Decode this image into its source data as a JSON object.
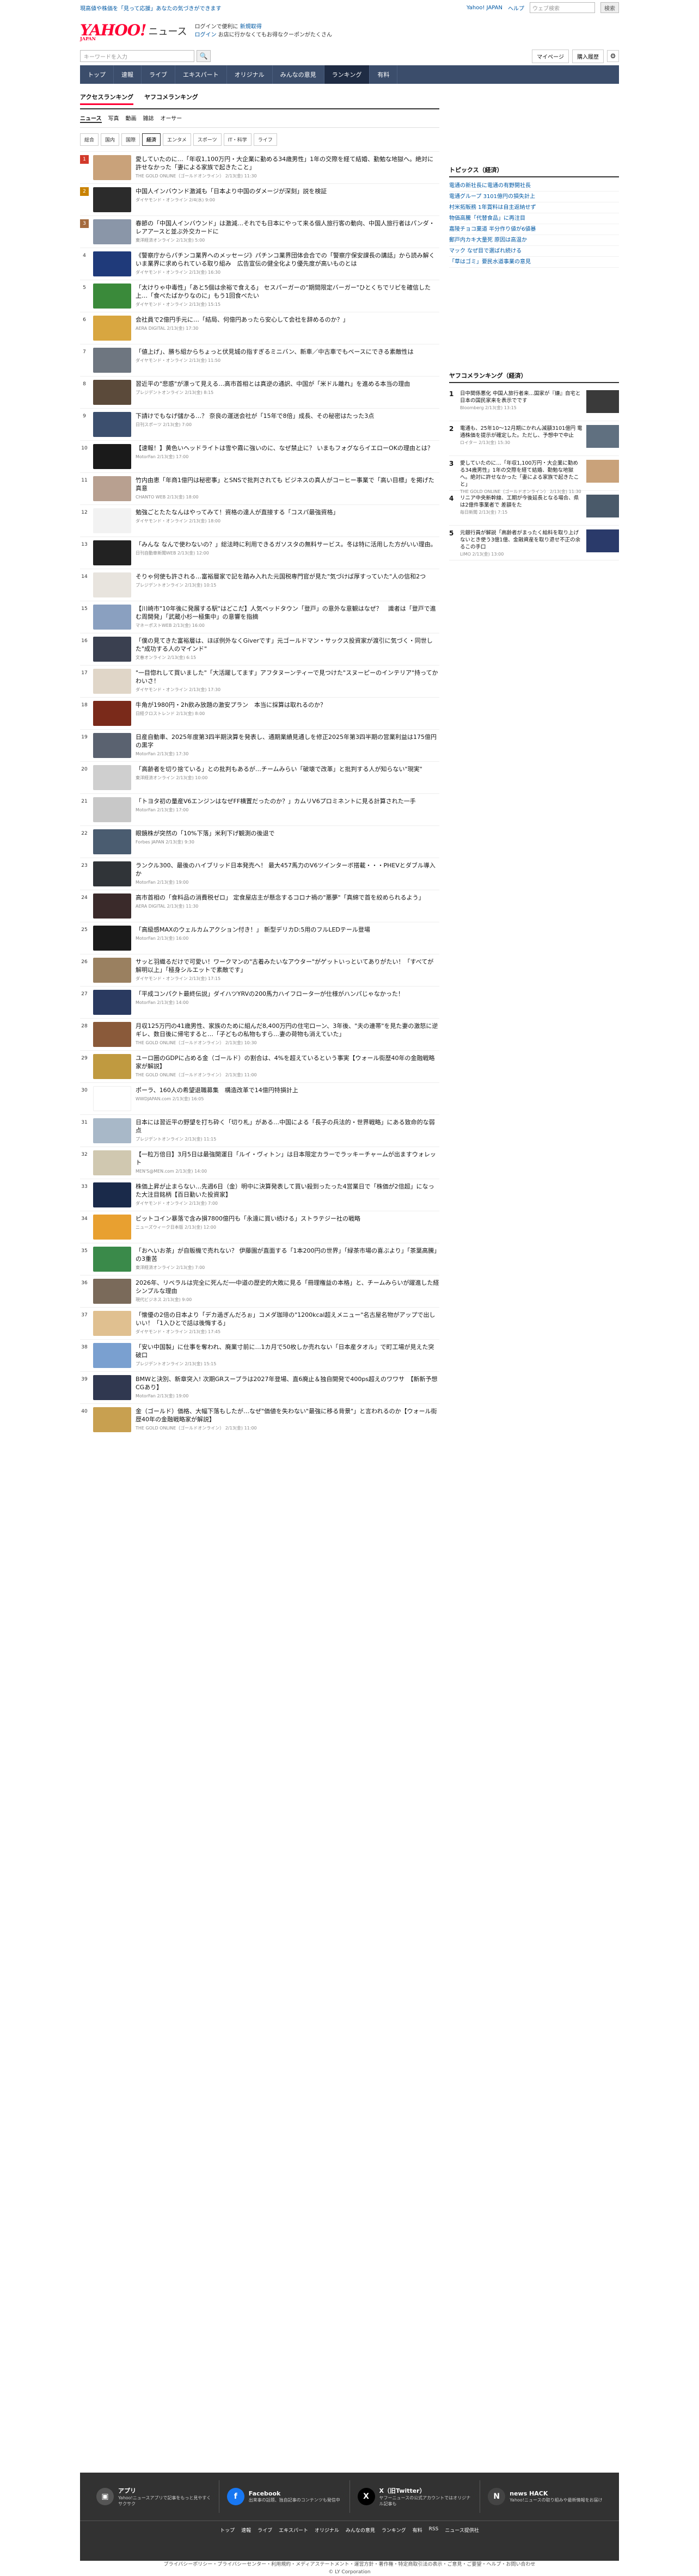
{
  "header": {
    "notice": "現高値や株価を「見って応援」あなたの気づきができます",
    "links": [
      "Yahoo! JAPAN",
      "ヘルプ"
    ],
    "search_placeholder": "ウェブ検索",
    "search_btn": "検索",
    "promo_line1": "ログインで便利に",
    "promo_line2": "新規取得",
    "promo_line3": "ログイン",
    "promo_line4": "お店に行かなくてもお得なクーポンがたくさん",
    "logo": "YAHOO!",
    "logo_sub": "JAPAN",
    "news": "ニュース",
    "kw_placeholder": "キーワードを入力",
    "mypage": "マイページ",
    "buy": "購入履歴"
  },
  "nav": [
    "トップ",
    "速報",
    "ライブ",
    "エキスパート",
    "オリジナル",
    "みんなの意見",
    "ランキング",
    "有料"
  ],
  "nav_active": 6,
  "tabs1": [
    "アクセスランキング",
    "ヤフコメランキング"
  ],
  "tabs2": [
    "ニュース",
    "写真",
    "動画",
    "雑誌",
    "オーサー"
  ],
  "tabs3": [
    "総合",
    "国内",
    "国際",
    "経済",
    "エンタメ",
    "スポーツ",
    "IT・科学",
    "ライフ"
  ],
  "items": [
    {
      "n": "1",
      "t": "愛していたのに…「年収1,100万円・大企業に勤める34歳男性」1年の交際を経て結婚、勤勉な地獄へ。絶対に許せなかった「妻による家族で起きたこと」",
      "s": "THE GOLD ONLINE（ゴールドオンライン） 2/13(金) 11:30",
      "c": "#c9a27a"
    },
    {
      "n": "2",
      "t": "中国人インバウンド激減も「日本より中国のダメージが深刻」説を検証",
      "s": "ダイヤモンド・オンライン 2/4(水) 9:00",
      "c": "#2b2b2b"
    },
    {
      "n": "3",
      "t": "春節の「中国人インバウンド」は激減…それでも日本にやって来る個人旅行客の動向、中国人旅行者はパンダ・レアアースと並ぶ外交カードに",
      "s": "東洋経済オンライン 2/13(金) 5:00",
      "c": "#8a96a8"
    },
    {
      "n": "4",
      "t": "《警察庁からパチンコ業界へのメッセージ》パチンコ業界団体会合での「警察庁保安課長の講話」から読み解くいま業界に求められている取り組み　広告宣伝の健全化より優先度が高いものとは",
      "s": "ダイヤモンド・オンライン 2/13(金) 16:30",
      "c": "#1f3a7a"
    },
    {
      "n": "5",
      "t": "「太けりゃ中毒性」「あと5個は余裕で食える」 セスパーガーの\"期間限定バーガー\"ひとくちでリピを確信した上…「食べたばかりなのに」もう1回食べたい",
      "s": "ダイヤモンド・オンライン 2/13(金) 15:15",
      "c": "#3a8a3a"
    },
    {
      "n": "6",
      "t": "会社員で2億円手元に…「結局、何億円あったら安心して会社を辞めるのか？」",
      "s": "AERA DIGITAL 2/13(金) 17:30",
      "c": "#d8a640"
    },
    {
      "n": "7",
      "t": "「値上げ」、勝ち組からちょっと伏見城の指すぎるミニバン、新車／中古車でもベースにできる素敵性は",
      "s": "ダイヤモンド・オンライン 2/13(金) 11:50",
      "c": "#6e7680"
    },
    {
      "n": "8",
      "t": "習近平の\"悲惑\"が漂って見える…高市首相とは真逆の通訳、中国が「米ドル離れ」を進める本当の理由",
      "s": "プレジデントオンライン 2/13(金) 8:15",
      "c": "#5b4a3a"
    },
    {
      "n": "9",
      "t": "下請けでもなげ儲かる…？ 奈良の運送会社が「15年で8倍」成長、その秘密はたった3点",
      "s": "日刊スポーツ 2/13(金) 7:00",
      "c": "#3c4f6e"
    },
    {
      "n": "10",
      "t": "【速報！】黄色いヘッドライトは雪や霧に強いのに、なぜ禁止に？ いまもフォグならイエローOKの理由とは？",
      "s": "MotorFan 2/13(金) 17:00",
      "c": "#1a1a1a"
    },
    {
      "n": "11",
      "t": "竹内由恵「年商1億円は秘密事」とSNSで批判されても ビジネスの真人がコーヒー事業で「高い目標」を掲げた真意",
      "s": "CHANTO WEB 2/13(金) 18:00",
      "c": "#b8a090"
    },
    {
      "n": "12",
      "t": "勉強ごとたたなんはやってみて！資格の達人が直接する「コスパ最強資格」",
      "s": "ダイヤモンド・オンライン 2/13(金) 18:00",
      "c": "#f2f2f2"
    },
    {
      "n": "13",
      "t": "「みんな なんで使わないの？」総法時に利用できるガソスタの無料サービス。冬は特に活用した方がいい理由。",
      "s": "日刊自動車新聞WEB 2/13(金) 12:00",
      "c": "#222222"
    },
    {
      "n": "14",
      "t": "そりゃ何使も許される…富裕層家で記を踏み入れた元国税専門官が見た\"気づけば厚すっていた\"人の信和2つ",
      "s": "プレジデントオンライン 2/13(金) 10:15",
      "c": "#e8e4de"
    },
    {
      "n": "15",
      "t": "【川崎市\"10年後に発展する駅\"はどこだ】人気ベッドタウン「登戸」の意外な意観はなぜ？　識者は「登戸で進む周開発」「武蔵小杉一極集中」の意響を指摘",
      "s": "マネーポストWEB 2/13(金) 16:00",
      "c": "#8aa0c0"
    },
    {
      "n": "16",
      "t": "「僕の見てきた富裕層は、ほぼ例外なくGiverです」元ゴールドマン・サックス投資家が渡引に気づく・同世した\"成功する人のマインド\"",
      "s": "文春オンライン 2/13(金) 6:15",
      "c": "#3a4050"
    },
    {
      "n": "17",
      "t": "\"一目惚れして買いました\"「大活躍してます」アフタヌーンティーで見つけた\"スヌーピーのインテリア\"持ってかわいさ！",
      "s": "ダイヤモンド・オンライン 2/13(金) 17:30",
      "c": "#e0d6c8"
    },
    {
      "n": "18",
      "t": "牛角が1980円・2h飲み放題の激安プラン　本当に採算は取れるのか？",
      "s": "日経クロストレンド 2/13(金) 8:00",
      "c": "#7a2a1a"
    },
    {
      "n": "19",
      "t": "日産自動車、2025年度第3四半期決算を発表し、通期業績見通しを修正2025年第3四半期の営業利益は175億円の黒字",
      "s": "MotorFan 2/13(金) 17:30",
      "c": "#5a6270"
    },
    {
      "n": "20",
      "t": "「高齢者を切り捨ている」との批判もあるが…チームみらい「破壊で改革」と批判する人が知らない\"現実\"",
      "s": "東洋経済オンライン 2/13(金) 10:00",
      "c": "#cfcfcf"
    },
    {
      "n": "21",
      "t": "「トヨタ初の量産V6エンジンはなぜFF横置だったのか？」カムリV6プロミネントに見る計算された一手",
      "s": "MotorFan 2/13(金) 17:00",
      "c": "#c8c8c8"
    },
    {
      "n": "22",
      "t": "眼鏡株が突然の「10%下落」米利下げ観測の後退で",
      "s": "Forbes JAPAN 2/13(金) 9:30",
      "c": "#4a5c70"
    },
    {
      "n": "23",
      "t": "ランクル300、最後のハイブリッド日本発売へ！ 最大457馬力のV6ツインターボ搭載・・・PHEVとダブル導入か",
      "s": "MotorFan 2/13(金) 19:00",
      "c": "#303438"
    },
    {
      "n": "24",
      "t": "高市首相の「食料品の消費税ゼロ」 定食屋店主が懸念するコロナ禍の\"悪夢\"「真綿で首を絞められるよう」",
      "s": "AERA DIGITAL 2/13(金) 11:30",
      "c": "#3a2a2a"
    },
    {
      "n": "25",
      "t": "「高級感MAXのウェルカムアクション付き！」 新型デリカD:5用のフルLEDテール登場",
      "s": "MotorFan 2/13(金) 16:00",
      "c": "#1a1a1a"
    },
    {
      "n": "26",
      "t": "サッと羽織るだけで可愛い！ワークマンの\"古着みたいなアウター\"がゲットいっといてありがたい！「すべてが解明以上」「極身シルエットで素敵です」",
      "s": "ダイヤモンド・オンライン 2/13(金) 17:15",
      "c": "#9a8060"
    },
    {
      "n": "27",
      "t": "「平成コンパクト最終伝説」ダイハツYRVの200馬力ハイフロータ一が仕様がハンパじゃなかった！",
      "s": "MotorFan 2/13(金) 14:00",
      "c": "#2a3a60"
    },
    {
      "n": "28",
      "t": "月収125万円の41歳男性、家族のために組んだ8,400万円の住宅ローン、3年後、\"夫の連帯\"を見た妻の激怒に逆ギレ、数日後に帰宅すると…「子どもの私物もすら…妻の荷物も消えていた」",
      "s": "THE GOLD ONLINE（ゴールドオンライン） 2/13(金) 10:30",
      "c": "#8a5a3a"
    },
    {
      "n": "29",
      "t": "ユーロ圏のGDPに占める金（ゴールド）の割合は、4%を超えているという事実【ウォール街歴40年の金融戦略家が解説】",
      "s": "THE GOLD ONLINE（ゴールドオンライン） 2/13(金) 11:00",
      "c": "#c09a40"
    },
    {
      "n": "30",
      "t": "ポーラ、160人の希望退職募集　構造改革で14億円特損計上",
      "s": "WWDJAPAN.com 2/13(金) 16:05",
      "c": "#ffffff"
    },
    {
      "n": "31",
      "t": "日本には習近平の野望を打ち砕く「切り札」がある…中国による「長子の兵法的・世界戦略」にある致命的な弱点",
      "s": "プレジデントオンライン 2/13(金) 11:15",
      "c": "#a8b8c8"
    },
    {
      "n": "32",
      "t": "【一粒万倍日】3月5日は最強開運日「ルイ・ヴィトン」は日本限定カラーでラッキーチャームが出ますウォレット",
      "s": "MEN'S@MEN.com 2/13(金) 14:00",
      "c": "#d0c8b0"
    },
    {
      "n": "33",
      "t": "株価上昇が止まらない…先週6日（金）明中に決算発表して買い殺到ったった4営業日で「株価が2倍超」になった大注目銘柄【百日勤いた投資家】",
      "s": "ダイヤモンド・オンライン 2/13(金) 7:00",
      "c": "#1a2a4a"
    },
    {
      "n": "34",
      "t": "ビットコイン暴落で含み損7800億円も「永遠に買い続ける」ストラテジー社の戦略",
      "s": "ニューズウィーク日本版 2/13(金) 12:00",
      "c": "#e8a030"
    },
    {
      "n": "35",
      "t": "「おへいお茶」が自販機で売れない？ 伊藤園が直面する「1本200円の世界」「緑茶市場の喜ぶより」「茶葉高騰」の3重苦",
      "s": "東洋経済オンライン 2/13(金) 7:00",
      "c": "#3a8a4a"
    },
    {
      "n": "36",
      "t": "2026年、リベラルは完全に死んだ──中道の歴史的大敗に見る「冊理権益の本格」と、チームみらいが躍進した経シンプルな理由",
      "s": "現代ビジネス 2/13(金) 9:00",
      "c": "#7a6a5a"
    },
    {
      "n": "37",
      "t": "「懐優の2倍の日本より「デカ過ぎんだろぉ」コメダ珈琲の\"1200kcal超えメニュー\"名古屋名物がアップで出しいい！「1入ひとで話は後悔する」",
      "s": "ダイヤモンド・オンライン 2/13(金) 17:45",
      "c": "#e0c090"
    },
    {
      "n": "38",
      "t": "「安い中国製」に仕事を奪われ、廃業寸前に…1カ月で50枚しか売れない「日本産タオル」で町工場が見えた突破口",
      "s": "プレジデントオンライン 2/13(金) 15:15",
      "c": "#7aa0d0"
    },
    {
      "n": "39",
      "t": "BMWと決別、新章突入! 次期GRスープラは2027年登場、直6廃止＆独自開発で400ps超えのワワサ　【新新予想CGあり】",
      "s": "MotorFan 2/13(金) 19:00",
      "c": "#303850"
    },
    {
      "n": "40",
      "t": "金（ゴールド）価格、大幅下落もしたが…なぜ\"価値を失わない\"最強に移る背景\"」と言われるのか【ウォール街歴40年の金融戦略家が解説】",
      "s": "THE GOLD ONLINE（ゴールドオンライン） 2/13(金) 11:00",
      "c": "#c8a050"
    }
  ],
  "topics": {
    "title": "トピックス（経済）",
    "list": [
      "電通の新社長に電通の有野開社長",
      "電通グループ 3101億円の損失計上",
      "村米拓販務 1年賞料は自主返納せず",
      "物価高騰「代替食品」に再注目",
      "嘉陵チョコ菓道 半分作り値が6値暴",
      "郵戸内カキ大量死 原因は高温か",
      "マック なぜ目で選ばれ続ける",
      "「草はゴミ」要民水道事業の意見"
    ]
  },
  "yahoo_ranking": {
    "title": "ヤフコメランキング（経済）",
    "items": [
      {
        "n": "1",
        "t": "日中関係悪化 中国人旅行者来…国家が『嫌』自宅と日本の国民家来を表示でです",
        "s": "Bloomberg 2/13(金) 13:15",
        "c": "#3a3a3a"
      },
      {
        "n": "2",
        "t": "電通も、25年10〜12月期にかれん減額3101億円 電通株価を提示が確定した。ただし、予想中で中止",
        "s": "ロイター 2/13(金) 15:30",
        "c": "#607080"
      },
      {
        "n": "3",
        "t": "愛していたのに…「年収1,100万円・大企業に勤める34歳男性」1年の交際を経て結婚、勤勉な地獄へ。絶対に許せなかった「妻による家族で起きたこと」",
        "s": "THE GOLD ONLINE（ゴールドオンライン） 2/13(金) 11:30",
        "c": "#c9a27a"
      },
      {
        "n": "4",
        "t": "リニア中央新幹線、工期が今後延長となる場合、県は2億件事業者で 差額をた",
        "s": "毎日新聞 2/13(金) 7:15",
        "c": "#4a5a6a"
      },
      {
        "n": "5",
        "t": "元銀行員が解説「高齢者がまったく給料を取り上げないとき使う3億1億、金融資産を取り退せ不正の余るこの手口",
        "s": "LIMO 2/13(金) 13:00",
        "c": "#2a3a6a"
      }
    ]
  },
  "footer": {
    "cells": [
      {
        "h": "アプリ",
        "p": "Yahoo!ニュースアプリで記事をもっと見やすくサクサク",
        "icon": "app-icon",
        "c": "#555"
      },
      {
        "h": "Facebook",
        "p": "出来事の話題、独自記事のコンテンツも発信中",
        "icon": "facebook-icon",
        "c": "#1877f2"
      },
      {
        "h": "X（旧Twitter）",
        "p": "ヤフーニュースの公式アカウントではオリジナル記事も",
        "icon": "x-icon",
        "c": "#000"
      },
      {
        "h": "news HACK",
        "p": "Yahoo!ニュースの取り組みや最新情報をお届け",
        "icon": "newshack-icon",
        "c": "#444"
      }
    ],
    "links": [
      "トップ",
      "速報",
      "ライブ",
      "エキスパート",
      "オリジナル",
      "みんなの意見",
      "ランキング",
      "有料",
      "RSS",
      "ニュース提供社"
    ],
    "bottom1": "プライバシーポリシー・プライバシーセンター・利用規約・メディアステートメント・運営方針・著作権・特定商取引法の表示・ご意見・ご要望・ヘルプ・お問い合わせ",
    "bottom2": "© LY Corporation"
  }
}
